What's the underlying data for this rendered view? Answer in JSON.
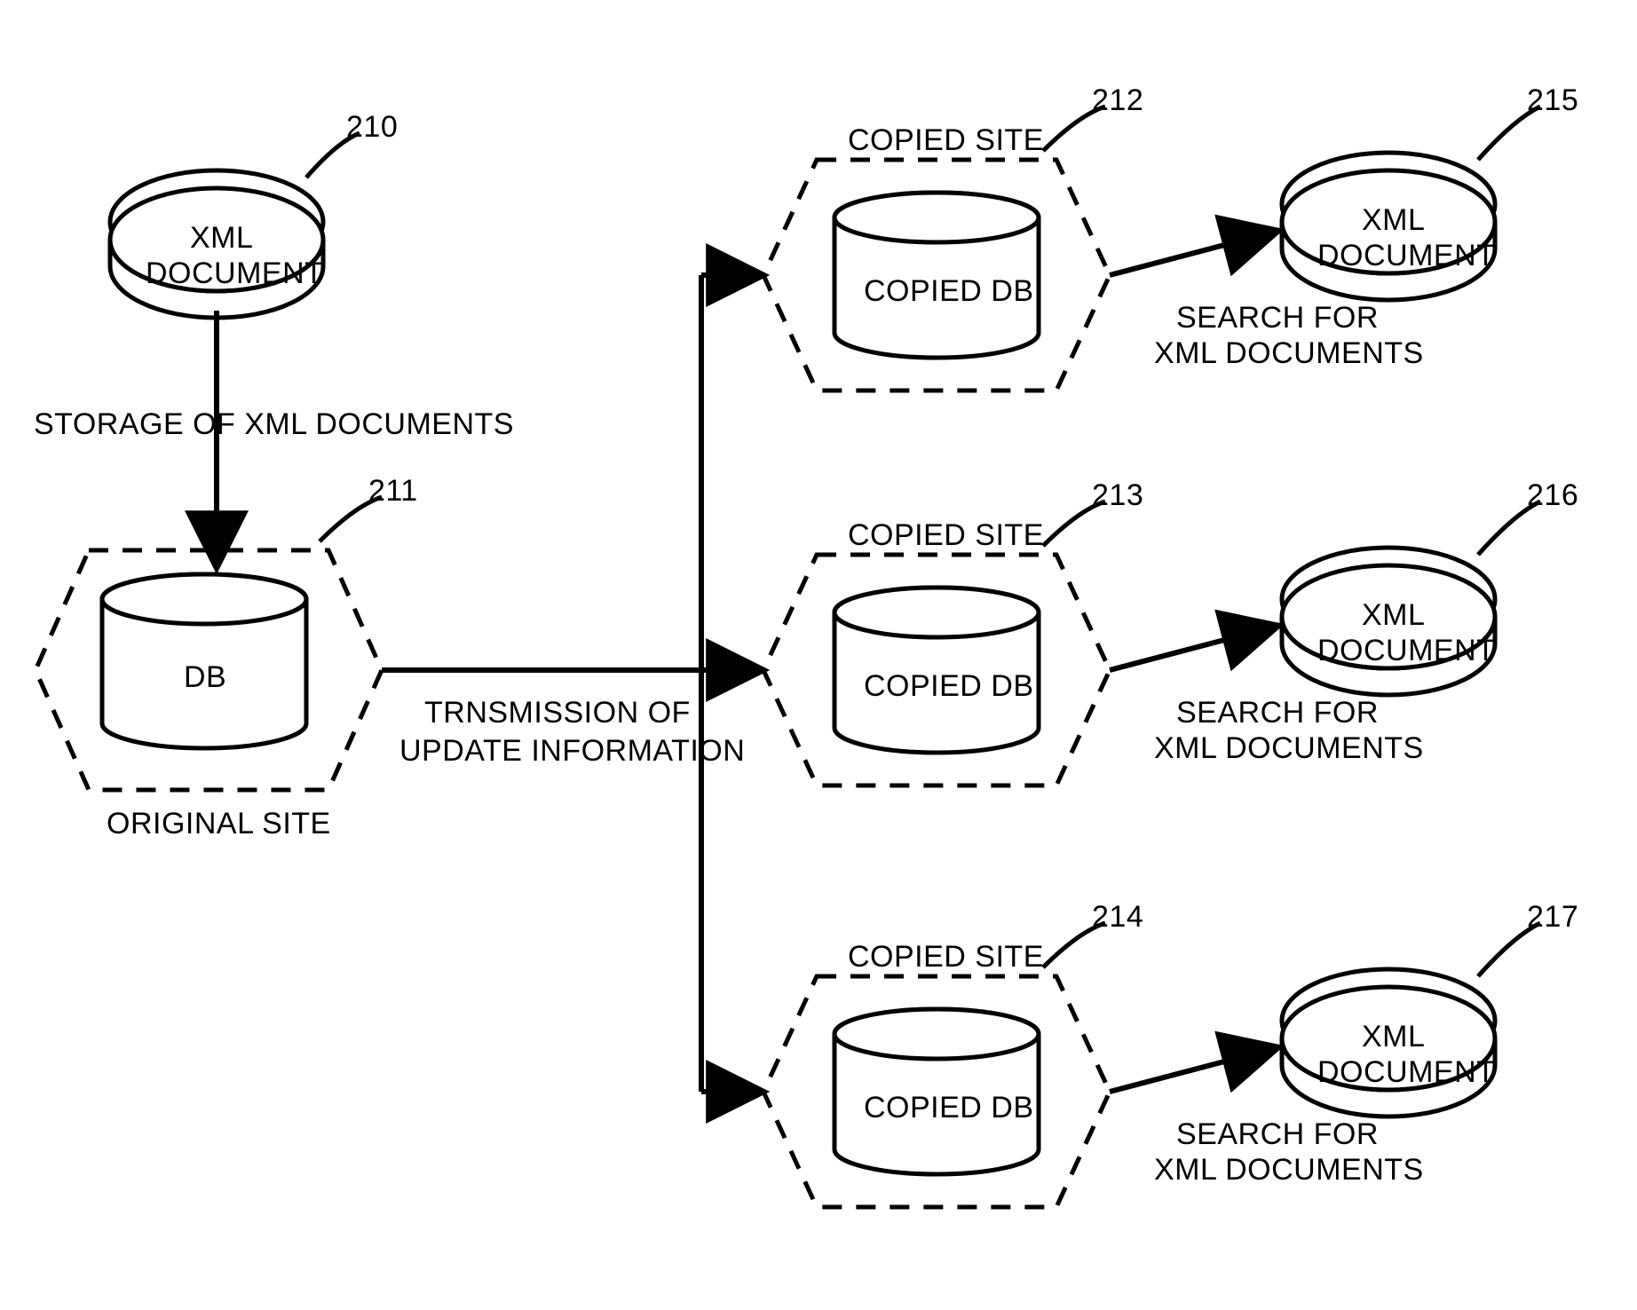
{
  "diagram": {
    "nodes": {
      "xml_doc_210": {
        "ref": "210",
        "line1": "XML",
        "line2": "DOCUMENT"
      },
      "original_site_211": {
        "ref": "211",
        "db_label": "DB",
        "site_label": "ORIGINAL SITE"
      },
      "copied_site_212": {
        "ref": "212",
        "db_label": "COPIED DB",
        "site_label": "COPIED SITE"
      },
      "copied_site_213": {
        "ref": "213",
        "db_label": "COPIED DB",
        "site_label": "COPIED SITE"
      },
      "copied_site_214": {
        "ref": "214",
        "db_label": "COPIED DB",
        "site_label": "COPIED SITE"
      },
      "xml_doc_215": {
        "ref": "215",
        "line1": "XML",
        "line2": "DOCUMENT"
      },
      "xml_doc_216": {
        "ref": "216",
        "line1": "XML",
        "line2": "DOCUMENT"
      },
      "xml_doc_217": {
        "ref": "217",
        "line1": "XML",
        "line2": "DOCUMENT"
      }
    },
    "edges": {
      "storage": "STORAGE OF XML DOCUMENTS",
      "transmission_l1": "TRNSMISSION OF",
      "transmission_l2": "UPDATE INFORMATION",
      "search_l1": "SEARCH FOR",
      "search_l2": "XML DOCUMENTS"
    }
  }
}
